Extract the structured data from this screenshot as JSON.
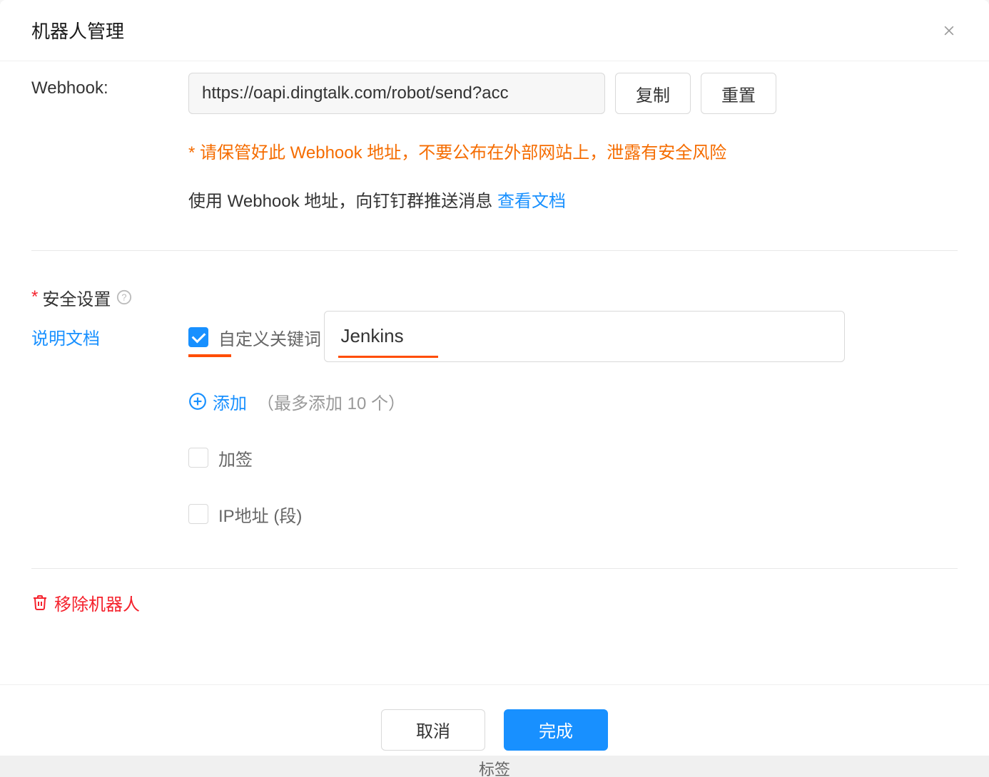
{
  "modal": {
    "title": "机器人管理"
  },
  "webhook": {
    "label": "Webhook:",
    "value": "https://oapi.dingtalk.com/robot/send?acc",
    "copy_btn": "复制",
    "reset_btn": "重置",
    "warning": "* 请保管好此 Webhook 地址，不要公布在外部网站上，泄露有安全风险",
    "info_prefix": "使用 Webhook 地址，向钉钉群推送消息 ",
    "doc_link": "查看文档"
  },
  "security": {
    "label": "安全设置",
    "doc_link": "说明文档",
    "custom_keyword_label": "自定义关键词",
    "keyword_value": "Jenkins",
    "add_label": "添加",
    "add_hint": "（最多添加 10 个）",
    "sign_label": "加签",
    "ip_label": "IP地址 (段)"
  },
  "remove": {
    "label": "移除机器人"
  },
  "footer": {
    "cancel": "取消",
    "confirm": "完成"
  },
  "bg_text": "标签"
}
